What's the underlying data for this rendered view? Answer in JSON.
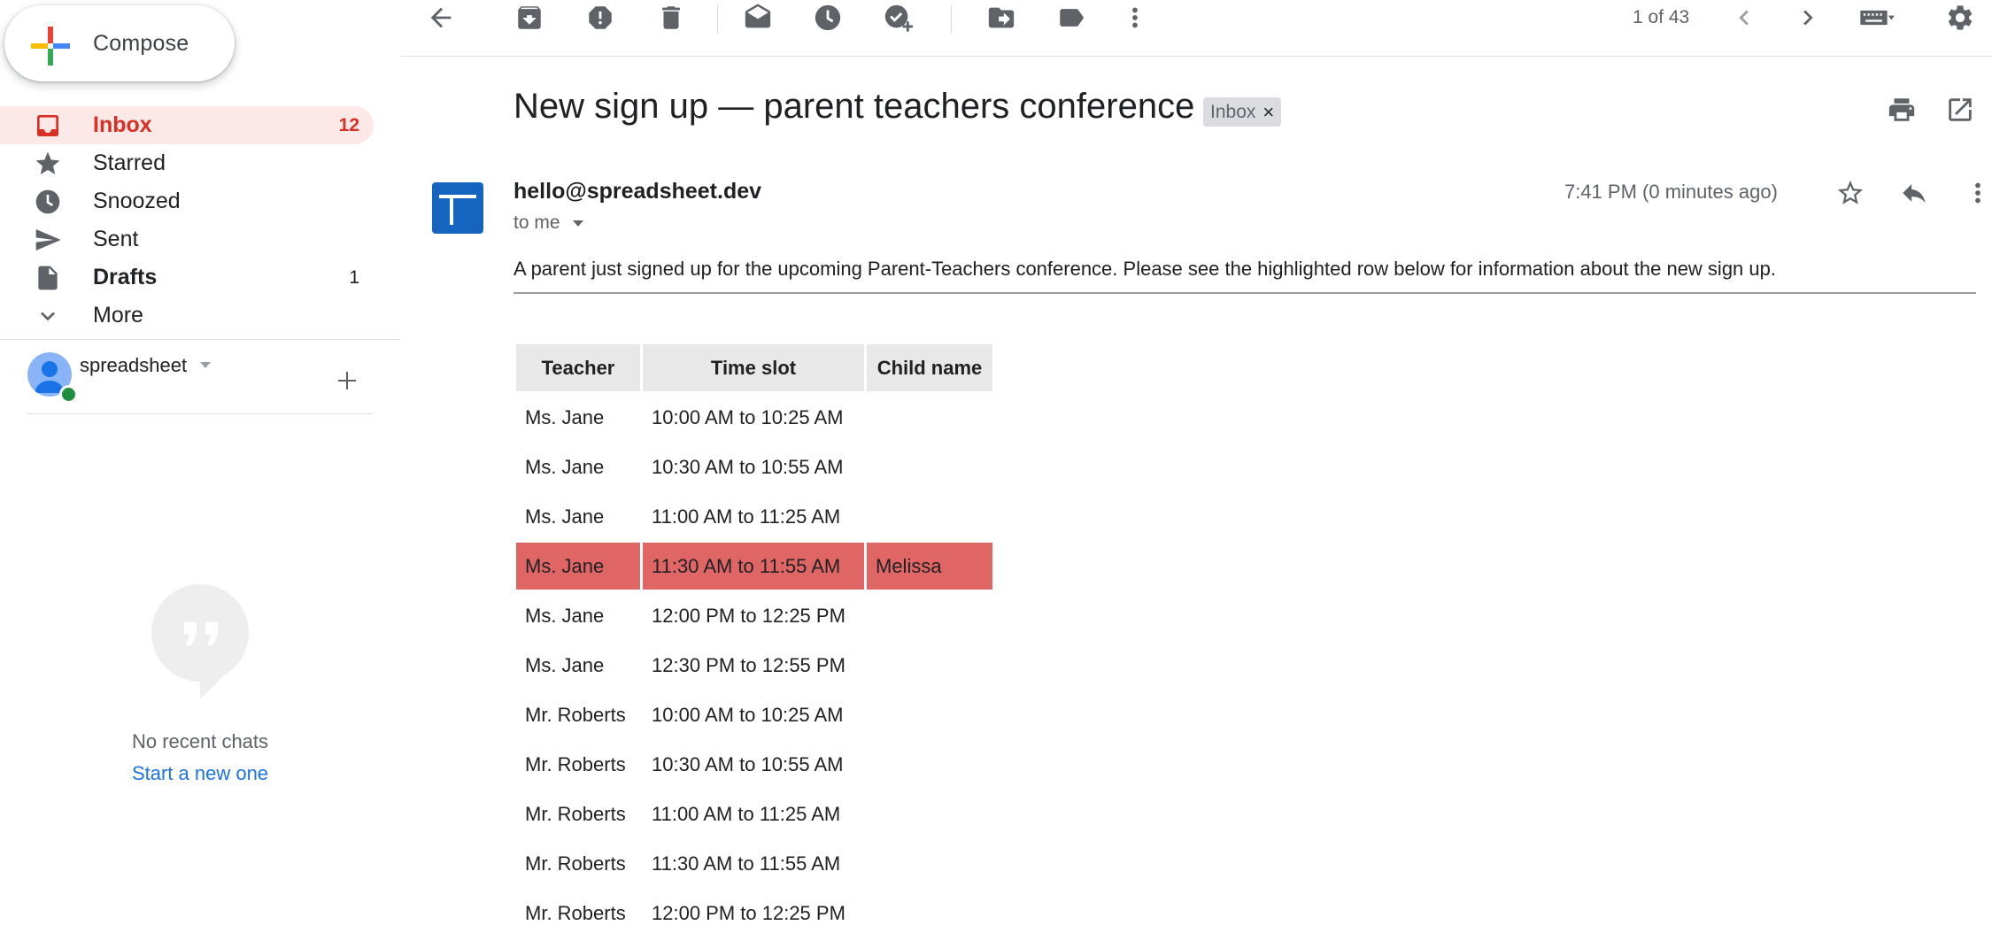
{
  "sidebar": {
    "compose_label": "Compose",
    "nav": [
      {
        "label": "Inbox",
        "count": "12",
        "icon": "inbox-icon",
        "active": true
      },
      {
        "label": "Starred",
        "count": "",
        "icon": "star-icon"
      },
      {
        "label": "Snoozed",
        "count": "",
        "icon": "clock-icon"
      },
      {
        "label": "Sent",
        "count": "",
        "icon": "send-icon"
      },
      {
        "label": "Drafts",
        "count": "1",
        "icon": "draft-icon",
        "bold": true
      },
      {
        "label": "More",
        "count": "",
        "icon": "chevron-down-icon"
      }
    ],
    "account_name": "spreadsheet",
    "no_chats": "No recent chats",
    "start_new": "Start a new one"
  },
  "toolbar": {
    "icons": [
      "back-arrow-icon",
      "archive-icon",
      "report-spam-icon",
      "delete-icon",
      "mark-unread-icon",
      "snooze-icon",
      "add-to-tasks-icon",
      "move-to-icon",
      "label-icon",
      "more-vert-icon"
    ],
    "pager": "1 of 43"
  },
  "message": {
    "subject": "New sign up — parent teachers conference",
    "label_chip": "Inbox",
    "sender": "hello@spreadsheet.dev",
    "to_me": "to me",
    "time": "7:41 PM (0 minutes ago)",
    "body": "A parent just signed up for the upcoming Parent-Teachers conference. Please see the highlighted row below for information about the new sign up.",
    "table": {
      "headers": [
        "Teacher",
        "Time slot",
        "Child name"
      ],
      "rows": [
        [
          "Ms. Jane",
          "10:00 AM to 10:25 AM",
          ""
        ],
        [
          "Ms. Jane",
          "10:30 AM to 10:55 AM",
          ""
        ],
        [
          "Ms. Jane",
          "11:00 AM to 11:25 AM",
          ""
        ],
        [
          "Ms. Jane",
          "11:30 AM to 11:55 AM",
          "Melissa"
        ],
        [
          "Ms. Jane",
          "12:00 PM to 12:25 PM",
          ""
        ],
        [
          "Ms. Jane",
          "12:30 PM to 12:55 PM",
          ""
        ],
        [
          "Mr. Roberts",
          "10:00 AM to 10:25 AM",
          ""
        ],
        [
          "Mr. Roberts",
          "10:30 AM to 10:55 AM",
          ""
        ],
        [
          "Mr. Roberts",
          "11:00 AM to 11:25 AM",
          ""
        ],
        [
          "Mr. Roberts",
          "11:30 AM to 11:55 AM",
          ""
        ],
        [
          "Mr. Roberts",
          "12:00 PM to 12:25 PM",
          ""
        ]
      ],
      "highlight_row": 3,
      "highlight_color": "#e06666"
    }
  },
  "colors": {
    "accent_red": "#d93025",
    "active_bg": "#fce8e6",
    "link_blue": "#1a73e8",
    "sender_avatar": "#1565c0"
  }
}
